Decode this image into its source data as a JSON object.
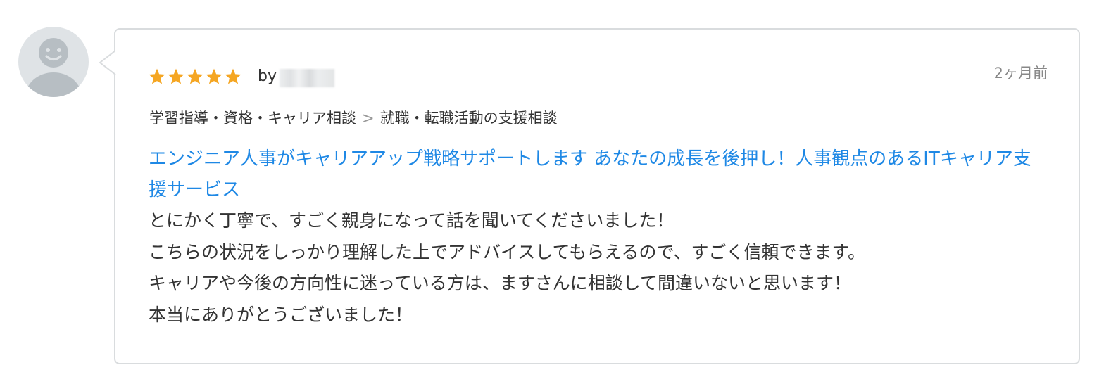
{
  "review": {
    "rating": 5,
    "max_rating": 5,
    "by_label": "by",
    "reviewer_name": "",
    "timestamp": "2ヶ月前",
    "breadcrumb": {
      "category": "学習指導・資格・キャリア相談",
      "separator": ">",
      "subcategory": "就職・転職活動の支援相談"
    },
    "service_title": "エンジニア人事がキャリアアップ戦略サポートします あなたの成長を後押し！人事観点のあるITキャリア支援サービス",
    "body_lines": [
      "とにかく丁寧で、すごく親身になって話を聞いてくださいました！",
      "こちらの状況をしっかり理解した上でアドバイスしてもらえるので、すごく信頼できます。",
      "キャリアや今後の方向性に迷っている方は、ますさんに相談して間違いないと思います！",
      "本当にありがとうございました！"
    ]
  },
  "icons": {
    "avatar": "default-user-avatar-icon",
    "star": "star-icon"
  },
  "colors": {
    "star": "#f5a623",
    "link": "#1e88e5",
    "text": "#333333",
    "muted": "#888888",
    "border": "#d9dcde",
    "avatar_bg": "#dfe3e6",
    "avatar_fg": "#b7bec3"
  }
}
